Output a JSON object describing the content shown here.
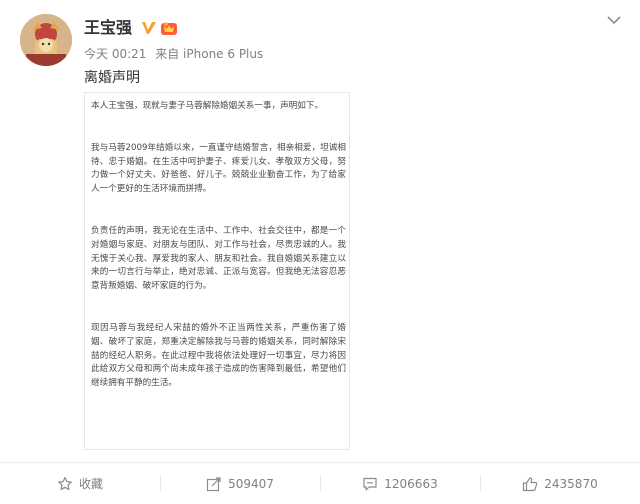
{
  "post": {
    "author": "王宝强",
    "timestamp": "今天 00:21",
    "source": "来自 iPhone 6 Plus",
    "text": "离婚声明"
  },
  "statement": {
    "paragraphs": [
      "本人王宝强，现就与妻子马蓉解除婚姻关系一事，声明如下。",
      "我与马蓉2009年结婚以来，一直谨守结婚誓言，相亲相爱，坦诚相待、忠于婚姻。在生活中呵护妻子、疼爱儿女、孝敬双方父母，努力做一个好丈夫、好爸爸、好儿子。兢兢业业勤奋工作，为了给家人一个更好的生活环境而拼搏。",
      "负责任的声明，我无论在生活中、工作中、社会交往中，都是一个对婚姻与家庭、对朋友与团队、对工作与社会，尽责忠诚的人。我无愧于关心我、厚爱我的家人、朋友和社会。我自婚姻关系建立以来的一切言行与举止，绝对忠诚、正派与宽容。但我绝无法容忍恶意背叛婚姻、破坏家庭的行为。",
      "现因马蓉与我经纪人宋喆的婚外不正当两性关系，严重伤害了婚姻、破坏了家庭，郑重决定解除我与马蓉的婚姻关系，同时解除宋喆的经纪人职务。在此过程中我将依法处理好一切事宜，尽力将因此给双方父母和两个尚未成年孩子造成的伤害降到最低，希望他们继续拥有平静的生活。"
    ]
  },
  "actions": {
    "favorite_label": "收藏",
    "repost_count": "509407",
    "comment_count": "1206663",
    "like_count": "2435870"
  },
  "icons": {
    "vip": "verified-v-icon",
    "member": "member-crown-icon",
    "menu": "chevron-down-icon",
    "favorite": "star-icon",
    "repost": "share-icon",
    "comment": "comment-icon",
    "like": "thumbs-up-icon"
  },
  "colors": {
    "name": "#333333",
    "meta": "#808080",
    "vip": "#f7a12a",
    "member": "#ff5c38"
  }
}
